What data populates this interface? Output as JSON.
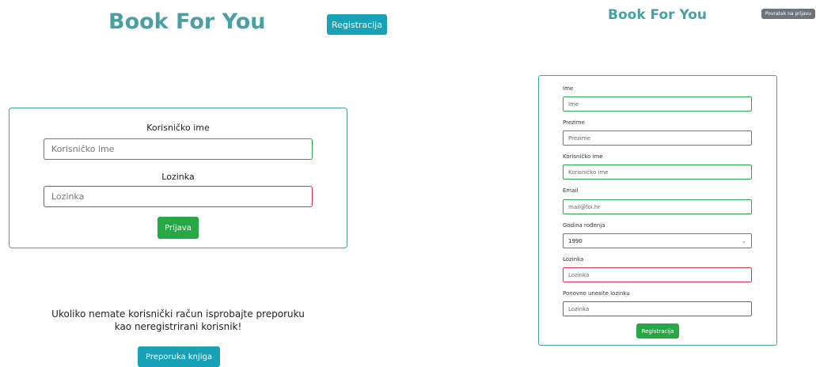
{
  "left_header": {
    "brand": "Book For You",
    "register_button": "Registracija"
  },
  "login": {
    "username_label": "Korisničko ime",
    "username_placeholder": "Korisničko ime",
    "password_label": "Lozinka",
    "password_placeholder": "Lozinka",
    "submit": "Prijava"
  },
  "promo": {
    "line1": "Ukoliko nemate korisnički račun isprobajte preporuku",
    "line2": "kao neregistrirani korisnik!",
    "button": "Preporuka knjiga"
  },
  "right_header": {
    "brand": "Book For You",
    "back_button": "Povratak na prijavu"
  },
  "registration": {
    "fields": [
      {
        "label": "Ime",
        "placeholder": "Ime",
        "state": "valid"
      },
      {
        "label": "Prezime",
        "placeholder": "Prezime",
        "state": "valid"
      },
      {
        "label": "Korisničko ime",
        "placeholder": "Korisničko ime",
        "state": "valid"
      },
      {
        "label": "Email",
        "placeholder": "mail@foi.hr",
        "state": "valid"
      },
      {
        "label": "Godina rođenja",
        "value": "1990",
        "state": "valid",
        "type": "select"
      },
      {
        "label": "Lozinka",
        "placeholder": "Lozinka",
        "state": "invalid"
      },
      {
        "label": "Ponovno unesite lozinku",
        "placeholder": "Lozinka",
        "state": "invalid"
      }
    ],
    "submit": "Registracija"
  },
  "colors": {
    "brand": "#4a9fa5",
    "teal_button": "#17a2b8",
    "green_button": "#28a745",
    "valid_border": "#28a745",
    "invalid_border": "#dc3545",
    "grey_button": "#6c757d"
  },
  "icons": {
    "select_arrow": "chevron-down-icon"
  }
}
